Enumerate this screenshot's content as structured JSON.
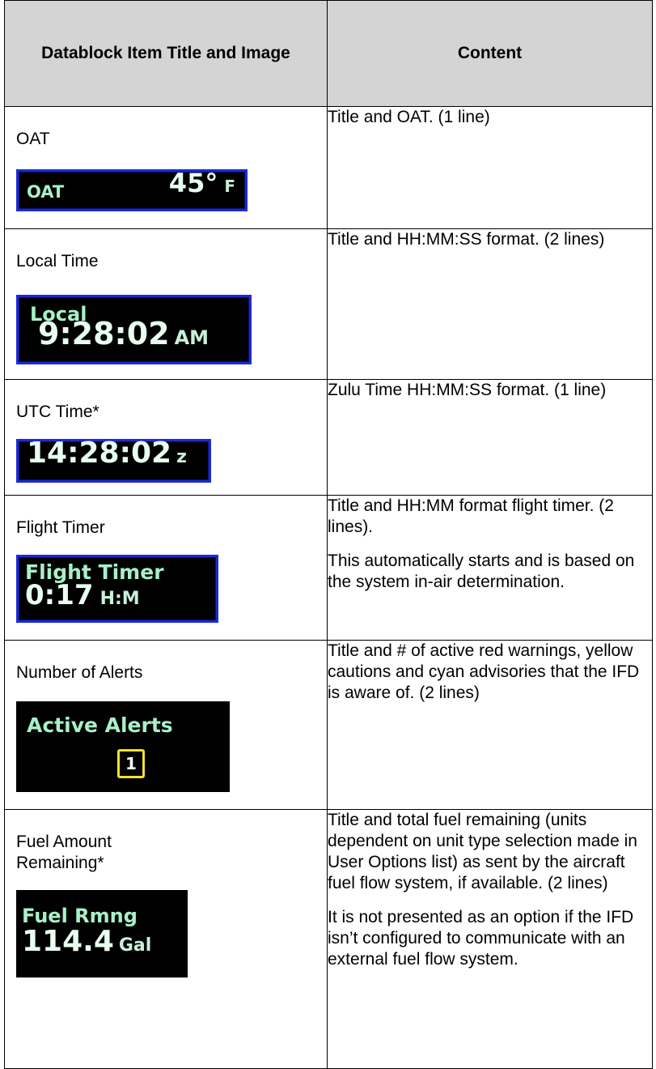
{
  "header": {
    "col1": "Datablock Item Title and Image",
    "col2": "Content"
  },
  "rows": [
    {
      "title": "OAT",
      "content": [
        "Title and OAT. (1 line)"
      ],
      "display": {
        "label": "OAT",
        "value": "45°",
        "unit": "F"
      }
    },
    {
      "title": "Local Time",
      "content": [
        "Title and HH:MM:SS format. (2 lines)"
      ],
      "display": {
        "label": "Local",
        "value": "9:28:02",
        "unit": "AM"
      }
    },
    {
      "title": "UTC Time*",
      "content": [
        "Zulu Time HH:MM:SS format. (1 line)"
      ],
      "display": {
        "value": "14:28:02",
        "unit": "z"
      }
    },
    {
      "title": "Flight Timer",
      "content": [
        "Title and HH:MM format flight timer. (2 lines).",
        "This automatically starts and is based on the system in-air determination."
      ],
      "display": {
        "label": "Flight Timer",
        "value": "0:17",
        "unit": "H:M"
      }
    },
    {
      "title": "Number of Alerts",
      "content": [
        "Title and # of active red warnings, yellow cautions and cyan advisories that the IFD is aware of.  (2 lines)"
      ],
      "display": {
        "label": "Active Alerts",
        "value": "1"
      }
    },
    {
      "title": "Fuel Amount Remaining*",
      "content": [
        "Title and total fuel remaining (units dependent on unit type selection made in User Options list) as sent by the aircraft fuel flow system, if available. (2 lines)",
        "It is not presented as an option if the IFD isn’t configured to communicate with an external fuel flow system."
      ],
      "display": {
        "label": "Fuel Rmng",
        "value": "114.4",
        "unit": "Gal"
      }
    }
  ],
  "colors": {
    "display_bg": "#000000",
    "display_border": "#1a2ad8",
    "display_text": "#a8f0c8",
    "caution_yellow": "#f0e030"
  }
}
